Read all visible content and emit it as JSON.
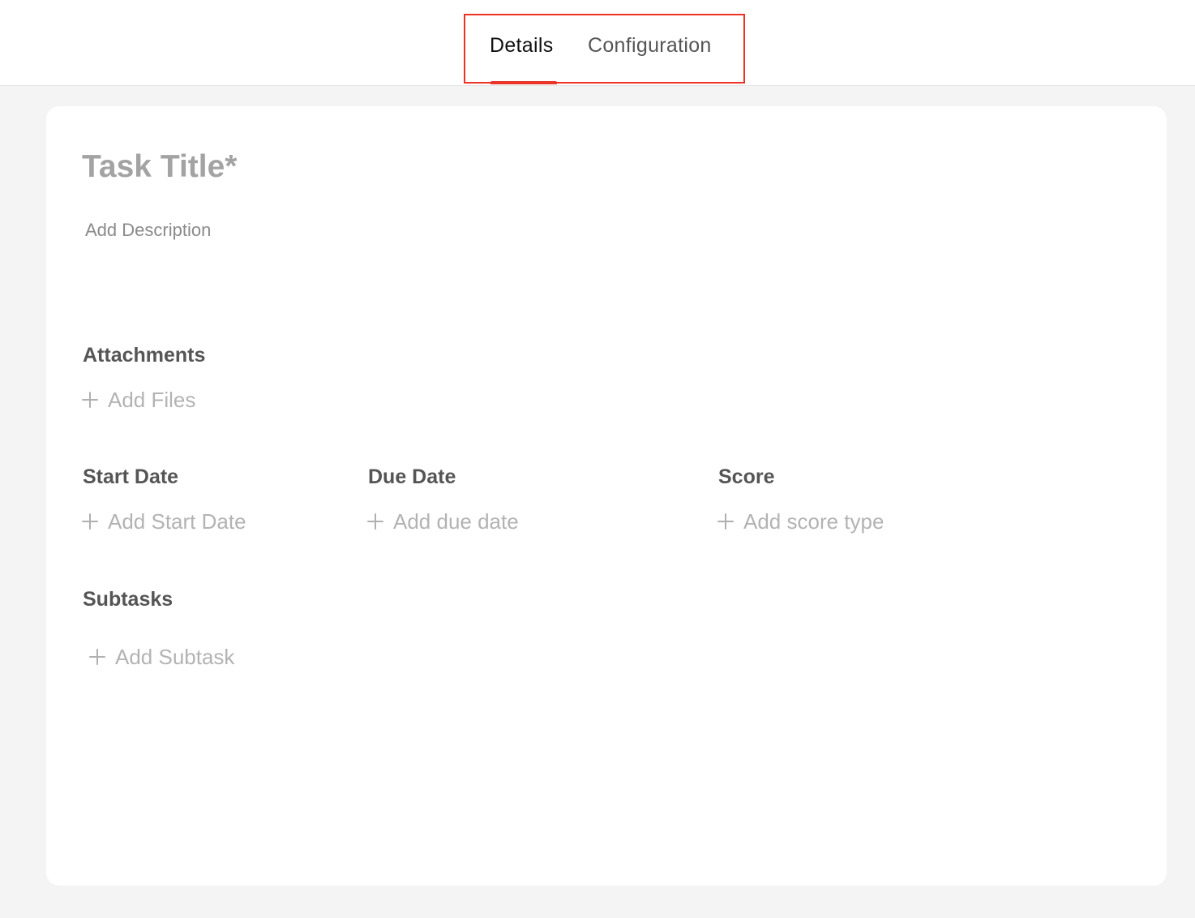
{
  "tabs": {
    "details": "Details",
    "configuration": "Configuration",
    "active": "Details"
  },
  "colors": {
    "accent": "#e53935",
    "highlight_box": "#ee3322",
    "page_background": "#f4f4f4",
    "card_background": "#ffffff",
    "placeholder_text": "#a3a3a3",
    "section_label": "#555555"
  },
  "task": {
    "title_placeholder": "Task Title*",
    "description_placeholder": "Add Description"
  },
  "attachments": {
    "label": "Attachments",
    "action": "Add Files",
    "icon": "plus-icon"
  },
  "start_date": {
    "label": "Start Date",
    "action": "Add Start Date",
    "icon": "plus-icon"
  },
  "due_date": {
    "label": "Due Date",
    "action": "Add due date",
    "icon": "plus-icon"
  },
  "score": {
    "label": "Score",
    "action": "Add score type",
    "icon": "plus-icon"
  },
  "subtasks": {
    "label": "Subtasks",
    "action": "Add Subtask",
    "icon": "plus-icon"
  }
}
